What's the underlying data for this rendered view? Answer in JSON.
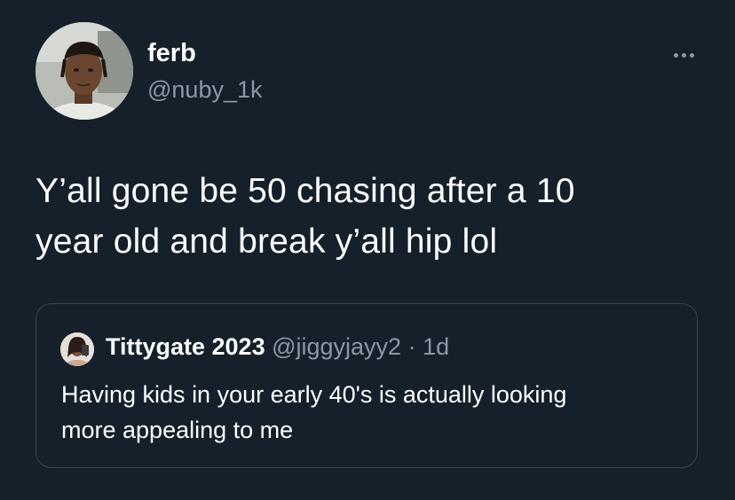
{
  "author": {
    "display_name": "ferb",
    "handle": "@nuby_1k",
    "avatar_icon": "profile-photo"
  },
  "menu": {
    "icon": "more-dots-icon"
  },
  "tweet": {
    "text_lines": [
      "Y’all gone be 50 chasing after a 10",
      "year old and break y’all hip lol"
    ]
  },
  "quoted_tweet": {
    "display_name": "Tittygate 2023",
    "handle": "@jiggyjayy2",
    "separator": "·",
    "time": "1d",
    "text_lines": [
      "Having kids in your early 40's is actually looking",
      "more appealing to me"
    ]
  },
  "colors": {
    "background": "#15202b",
    "primary_text": "#ffffff",
    "secondary_text": "#8b98a5",
    "border": "#38444d"
  }
}
